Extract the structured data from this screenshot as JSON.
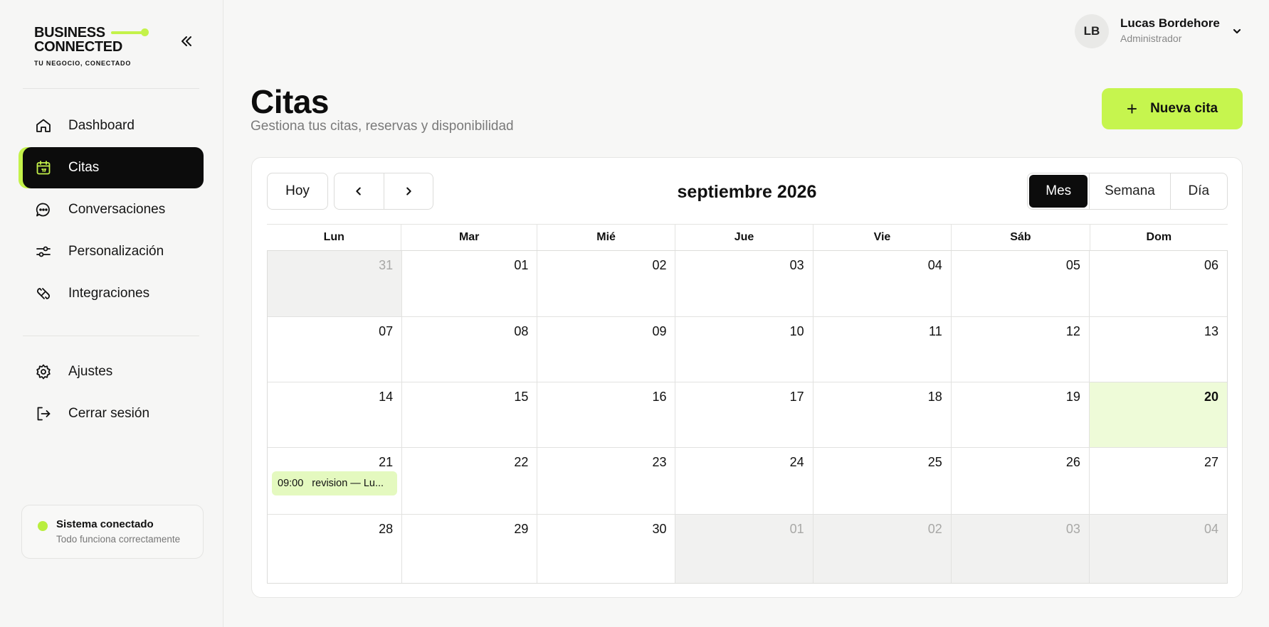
{
  "brand": {
    "line1": "BUSINESS",
    "line2": "CONNECTED",
    "tagline": "TU NEGOCIO, CONECTADO",
    "accent_color": "#c4f24a"
  },
  "sidebar": {
    "collapse_icon": "double-chevron-left-icon",
    "items": [
      {
        "label": "Dashboard",
        "icon": "home-icon",
        "active": false
      },
      {
        "label": "Citas",
        "icon": "calendar-icon",
        "active": true
      },
      {
        "label": "Conversaciones",
        "icon": "chat-bubble-icon",
        "active": false
      },
      {
        "label": "Personalización",
        "icon": "sliders-icon",
        "active": false
      },
      {
        "label": "Integraciones",
        "icon": "integration-icon",
        "active": false
      }
    ],
    "bottom_items": [
      {
        "label": "Ajustes",
        "icon": "gear-icon"
      },
      {
        "label": "Cerrar sesión",
        "icon": "logout-icon"
      }
    ],
    "status": {
      "title": "Sistema conectado",
      "subtitle": "Todo funciona correctamente",
      "color": "#b9ee3e"
    }
  },
  "user": {
    "initials": "LB",
    "name": "Lucas Bordehore",
    "role": "Administrador"
  },
  "page": {
    "title": "Citas",
    "subtitle": "Gestiona tus citas, reservas y disponibilidad",
    "new_button": "Nueva cita",
    "new_button_plus": "+"
  },
  "calendar": {
    "today_label": "Hoy",
    "month_title": "septiembre 2026",
    "views": [
      {
        "label": "Mes",
        "active": true
      },
      {
        "label": "Semana",
        "active": false
      },
      {
        "label": "Día",
        "active": false
      }
    ],
    "weekdays": [
      "Lun",
      "Mar",
      "Mié",
      "Jue",
      "Vie",
      "Sáb",
      "Dom"
    ],
    "weeks": [
      [
        {
          "d": "31",
          "muted": true
        },
        {
          "d": "01"
        },
        {
          "d": "02"
        },
        {
          "d": "03"
        },
        {
          "d": "04"
        },
        {
          "d": "05"
        },
        {
          "d": "06"
        }
      ],
      [
        {
          "d": "07"
        },
        {
          "d": "08"
        },
        {
          "d": "09"
        },
        {
          "d": "10"
        },
        {
          "d": "11"
        },
        {
          "d": "12"
        },
        {
          "d": "13"
        }
      ],
      [
        {
          "d": "14"
        },
        {
          "d": "15"
        },
        {
          "d": "16"
        },
        {
          "d": "17"
        },
        {
          "d": "18"
        },
        {
          "d": "19"
        },
        {
          "d": "20",
          "today": true
        }
      ],
      [
        {
          "d": "21",
          "event": {
            "time": "09:00",
            "title": "revision — Lu..."
          }
        },
        {
          "d": "22"
        },
        {
          "d": "23"
        },
        {
          "d": "24"
        },
        {
          "d": "25"
        },
        {
          "d": "26"
        },
        {
          "d": "27"
        }
      ],
      [
        {
          "d": "28"
        },
        {
          "d": "29"
        },
        {
          "d": "30"
        },
        {
          "d": "01",
          "muted": true
        },
        {
          "d": "02",
          "muted": true
        },
        {
          "d": "03",
          "muted": true
        },
        {
          "d": "04",
          "muted": true
        }
      ]
    ]
  }
}
